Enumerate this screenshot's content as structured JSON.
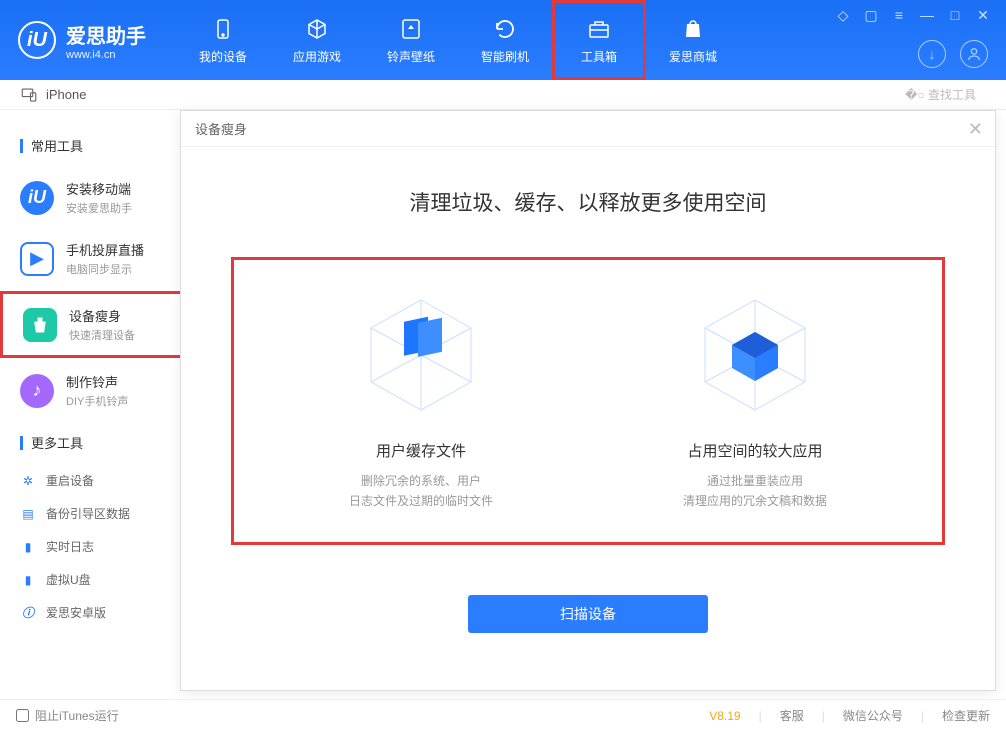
{
  "app": {
    "title": "爱思助手",
    "url": "www.i4.cn"
  },
  "nav": {
    "tabs": [
      {
        "label": "我的设备",
        "icon": "device"
      },
      {
        "label": "应用游戏",
        "icon": "cube"
      },
      {
        "label": "铃声壁纸",
        "icon": "music"
      },
      {
        "label": "智能刷机",
        "icon": "refresh"
      },
      {
        "label": "工具箱",
        "icon": "toolbox"
      },
      {
        "label": "爱思商城",
        "icon": "bag"
      }
    ]
  },
  "device": {
    "name": "iPhone",
    "search_placeholder": "查找工具"
  },
  "sidebar": {
    "section1": "常用工具",
    "items_big": [
      {
        "title": "安装移动端",
        "sub": "安装爱思助手",
        "color": "blue"
      },
      {
        "title": "手机投屏直播",
        "sub": "电脑同步显示",
        "color": "cast"
      },
      {
        "title": "设备瘦身",
        "sub": "快速清理设备",
        "color": "teal"
      },
      {
        "title": "制作铃声",
        "sub": "DIY手机铃声",
        "color": "purple"
      }
    ],
    "section2": "更多工具",
    "items_small": [
      {
        "label": "重启设备",
        "icon": "restart"
      },
      {
        "label": "备份引导区数据",
        "icon": "backup"
      },
      {
        "label": "实时日志",
        "icon": "log"
      },
      {
        "label": "虚拟U盘",
        "icon": "usb"
      },
      {
        "label": "爱思安卓版",
        "icon": "android"
      }
    ]
  },
  "modal": {
    "header": "设备瘦身",
    "title": "清理垃圾、缓存、以释放更多使用空间",
    "options": [
      {
        "title": "用户缓存文件",
        "desc1": "删除冗余的系统、用户",
        "desc2": "日志文件及过期的临时文件"
      },
      {
        "title": "占用空间的较大应用",
        "desc1": "通过批量重装应用",
        "desc2": "清理应用的冗余文稿和数据"
      }
    ],
    "scan_button": "扫描设备"
  },
  "footer": {
    "block_itunes": "阻止iTunes运行",
    "version": "V8.19",
    "service": "客服",
    "wechat": "微信公众号",
    "update": "检查更新"
  }
}
